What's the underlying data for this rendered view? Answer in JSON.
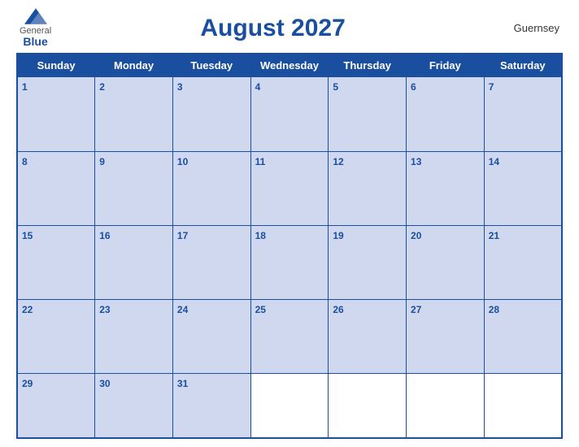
{
  "header": {
    "logo": {
      "general": "General",
      "blue": "Blue",
      "icon_color": "#1a4fa0"
    },
    "title": "August 2027",
    "region": "Guernsey"
  },
  "calendar": {
    "days_of_week": [
      "Sunday",
      "Monday",
      "Tuesday",
      "Wednesday",
      "Thursday",
      "Friday",
      "Saturday"
    ],
    "weeks": [
      [
        {
          "day": 1,
          "filled": true
        },
        {
          "day": 2,
          "filled": true
        },
        {
          "day": 3,
          "filled": true
        },
        {
          "day": 4,
          "filled": true
        },
        {
          "day": 5,
          "filled": true
        },
        {
          "day": 6,
          "filled": true
        },
        {
          "day": 7,
          "filled": true
        }
      ],
      [
        {
          "day": 8,
          "filled": true
        },
        {
          "day": 9,
          "filled": true
        },
        {
          "day": 10,
          "filled": true
        },
        {
          "day": 11,
          "filled": true
        },
        {
          "day": 12,
          "filled": true
        },
        {
          "day": 13,
          "filled": true
        },
        {
          "day": 14,
          "filled": true
        }
      ],
      [
        {
          "day": 15,
          "filled": true
        },
        {
          "day": 16,
          "filled": true
        },
        {
          "day": 17,
          "filled": true
        },
        {
          "day": 18,
          "filled": true
        },
        {
          "day": 19,
          "filled": true
        },
        {
          "day": 20,
          "filled": true
        },
        {
          "day": 21,
          "filled": true
        }
      ],
      [
        {
          "day": 22,
          "filled": true
        },
        {
          "day": 23,
          "filled": true
        },
        {
          "day": 24,
          "filled": true
        },
        {
          "day": 25,
          "filled": true
        },
        {
          "day": 26,
          "filled": true
        },
        {
          "day": 27,
          "filled": true
        },
        {
          "day": 28,
          "filled": true
        }
      ],
      [
        {
          "day": 29,
          "filled": true
        },
        {
          "day": 30,
          "filled": true
        },
        {
          "day": 31,
          "filled": true
        },
        {
          "day": null,
          "filled": false
        },
        {
          "day": null,
          "filled": false
        },
        {
          "day": null,
          "filled": false
        },
        {
          "day": null,
          "filled": false
        }
      ]
    ]
  }
}
